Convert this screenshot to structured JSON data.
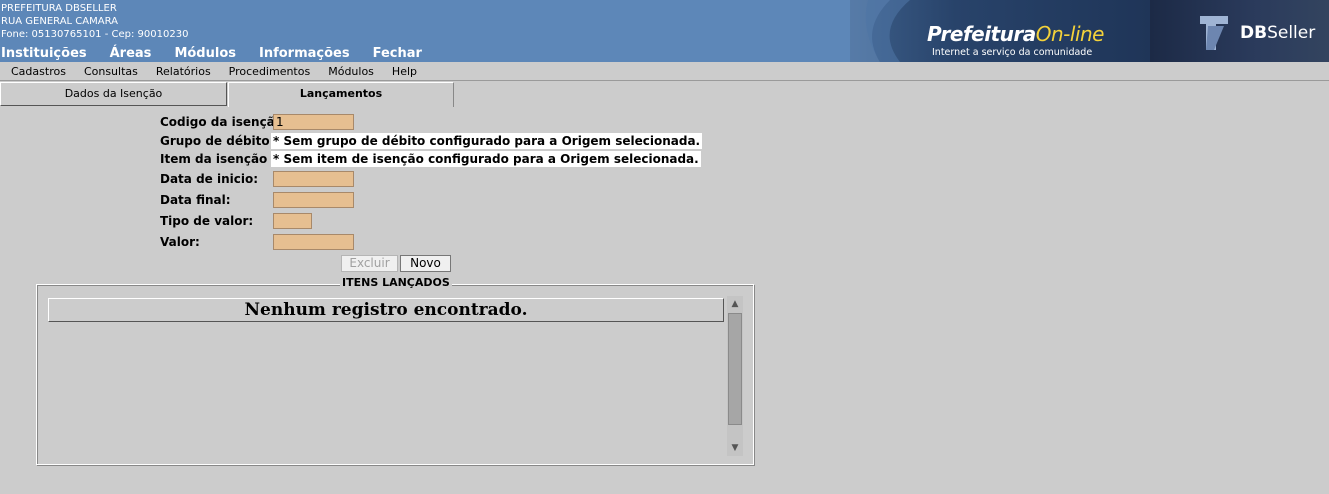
{
  "header": {
    "info_lines": [
      "PREFEITURA DBSELLER",
      "RUA GENERAL CAMARA",
      "Fone: 05130765101  -  Cep: 90010230"
    ],
    "nav": [
      "Instituições",
      "Áreas",
      "Módulos",
      "Informações",
      "Fechar"
    ],
    "brand_prefeitura": "Prefeitura",
    "brand_online": "On-line",
    "brand_subtitle": "Internet a serviço da comunidade",
    "dbseller_db": "DB",
    "dbseller_seller": "Seller",
    "colors": {
      "header_bg": "#5d87b8",
      "brand_accent": "#f4d23a"
    }
  },
  "menubar": [
    "Cadastros",
    "Consultas",
    "Relatórios",
    "Procedimentos",
    "Módulos",
    "Help"
  ],
  "tabs": [
    {
      "label": "Dados da Isenção",
      "active": false
    },
    {
      "label": "Lançamentos",
      "active": true
    }
  ],
  "form": {
    "codigo_label": "Codigo da isenção:",
    "codigo_value": "1",
    "grupo_label": "Grupo de débito :",
    "grupo_msg": "* Sem grupo de débito configurado para a Origem selecionada.",
    "item_label": "Item da isenção :",
    "item_msg": "* Sem item de isenção configurado para a Origem selecionada.",
    "inicio_label": "Data de inicio:",
    "final_label": "Data final:",
    "tipo_label": "Tipo de valor:",
    "valor_label": "Valor:",
    "field_color": "#e6bf91"
  },
  "buttons": {
    "excluir": "Excluir",
    "novo": "Novo"
  },
  "itens": {
    "legend": "ITENS LANÇADOS",
    "empty_message": "Nenhum registro encontrado."
  }
}
